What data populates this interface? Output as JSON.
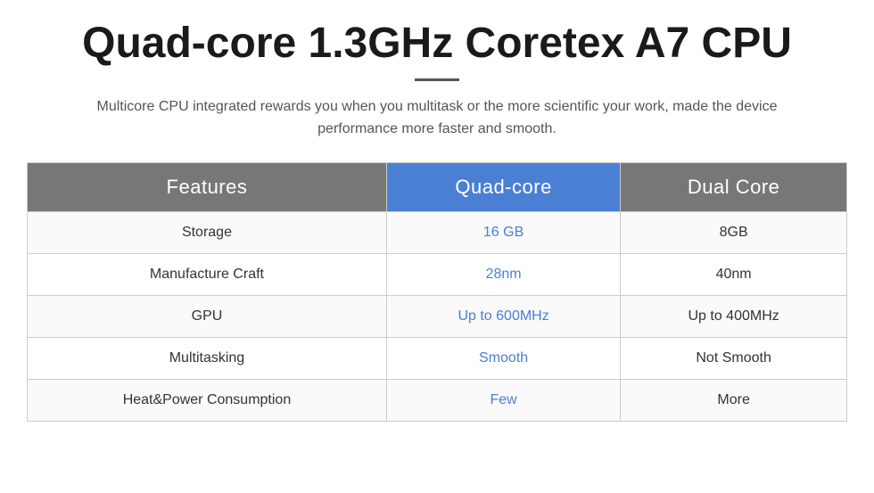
{
  "header": {
    "title": "Quad-core 1.3GHz Coretex A7 CPU",
    "subtitle": "Multicore CPU integrated rewards you when you multitask or the more scientific your work, made the device performance more faster and smooth."
  },
  "table": {
    "columns": {
      "features_label": "Features",
      "quad_label": "Quad-core",
      "dual_label": "Dual Core"
    },
    "rows": [
      {
        "feature": "Storage",
        "quad_value": "16 GB",
        "dual_value": "8GB"
      },
      {
        "feature": "Manufacture Craft",
        "quad_value": "28nm",
        "dual_value": "40nm"
      },
      {
        "feature": "GPU",
        "quad_value": "Up to 600MHz",
        "dual_value": "Up to 400MHz"
      },
      {
        "feature": "Multitasking",
        "quad_value": "Smooth",
        "dual_value": "Not Smooth"
      },
      {
        "feature": "Heat&Power Consumption",
        "quad_value": "Few",
        "dual_value": "More"
      }
    ]
  }
}
